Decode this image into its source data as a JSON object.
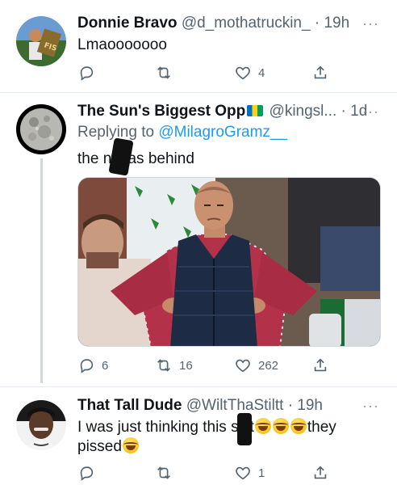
{
  "tweets": [
    {
      "name": "Donnie Bravo",
      "handle": "@d_mothatruckin_",
      "time": "· 19h",
      "text": "Lmaooooooo",
      "reply_count": "",
      "retweet_count": "",
      "like_count": "4"
    },
    {
      "name": "The Sun's Biggest Opp",
      "handle": "@kingsl...",
      "time": "· 1d",
      "replying_prefix": "Replying to",
      "replying_handle": "@MilagroGramz__",
      "text_before": "the ni",
      "text_after": "as behind",
      "image_alt": "Disappointed cricket fan standing with hands on hips in a crowd",
      "reply_count": "6",
      "retweet_count": "16",
      "like_count": "262"
    },
    {
      "name": "That Tall Dude",
      "handle": "@WiltThaStiltt",
      "time": "· 19h",
      "text_line1_before": "I was just thinking this s",
      "text_line1_mid": "t",
      "text_line1_after": "they",
      "text_line2": "pissed",
      "reply_count": "",
      "retweet_count": "",
      "like_count": "1"
    }
  ],
  "more_glyph": "···",
  "colors": {
    "accent": "#1d9bf0",
    "secondary_text": "#536471",
    "divider": "#e6ecf0"
  },
  "icons": [
    "reply-icon",
    "retweet-icon",
    "like-icon",
    "share-icon",
    "more-icon"
  ]
}
